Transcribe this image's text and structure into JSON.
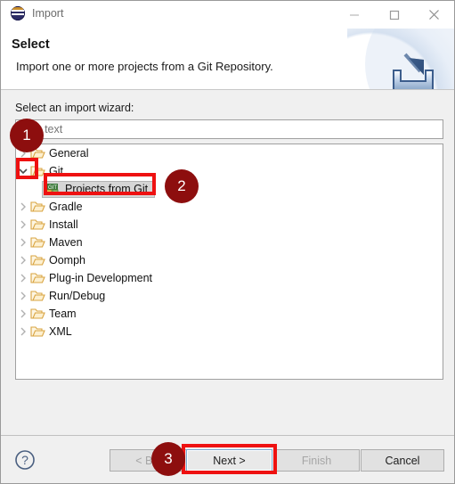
{
  "window": {
    "title": "Import",
    "app_icon": "eclipse-icon",
    "controls": {
      "minimize": "minimize-icon",
      "maximize": "maximize-icon",
      "close": "close-icon"
    }
  },
  "header": {
    "title": "Select",
    "description": "Import one or more projects from a Git Repository.",
    "banner_icon": "import-tray-icon"
  },
  "body": {
    "wizard_label": "Select an import wizard:",
    "filter": {
      "value": "",
      "placeholder": "filter text"
    },
    "tree": [
      {
        "label": "General",
        "expanded": false,
        "icon": "folder-icon",
        "level": 0,
        "selected": false
      },
      {
        "label": "Git",
        "expanded": true,
        "icon": "folder-icon",
        "level": 0,
        "selected": false
      },
      {
        "label": "Projects from Git",
        "expanded": null,
        "icon": "git-icon",
        "level": 1,
        "selected": true
      },
      {
        "label": "Gradle",
        "expanded": false,
        "icon": "folder-icon",
        "level": 0,
        "selected": false
      },
      {
        "label": "Install",
        "expanded": false,
        "icon": "folder-icon",
        "level": 0,
        "selected": false
      },
      {
        "label": "Maven",
        "expanded": false,
        "icon": "folder-icon",
        "level": 0,
        "selected": false
      },
      {
        "label": "Oomph",
        "expanded": false,
        "icon": "folder-icon",
        "level": 0,
        "selected": false
      },
      {
        "label": "Plug-in Development",
        "expanded": false,
        "icon": "folder-icon",
        "level": 0,
        "selected": false
      },
      {
        "label": "Run/Debug",
        "expanded": false,
        "icon": "folder-icon",
        "level": 0,
        "selected": false
      },
      {
        "label": "Team",
        "expanded": false,
        "icon": "folder-icon",
        "level": 0,
        "selected": false
      },
      {
        "label": "XML",
        "expanded": false,
        "icon": "folder-icon",
        "level": 0,
        "selected": false
      }
    ]
  },
  "footer": {
    "help_icon": "question-mark-icon",
    "buttons": {
      "back": "< Back",
      "next": "Next >",
      "finish": "Finish",
      "cancel": "Cancel"
    },
    "disabled": [
      "back",
      "finish"
    ]
  },
  "annotations": {
    "badges": [
      {
        "number": "1",
        "target": "git-expand-twisty"
      },
      {
        "number": "2",
        "target": "projects-from-git-item"
      },
      {
        "number": "3",
        "target": "next-button"
      }
    ],
    "highlight_color": "#ee1111",
    "badge_color": "#8d0e0e"
  }
}
